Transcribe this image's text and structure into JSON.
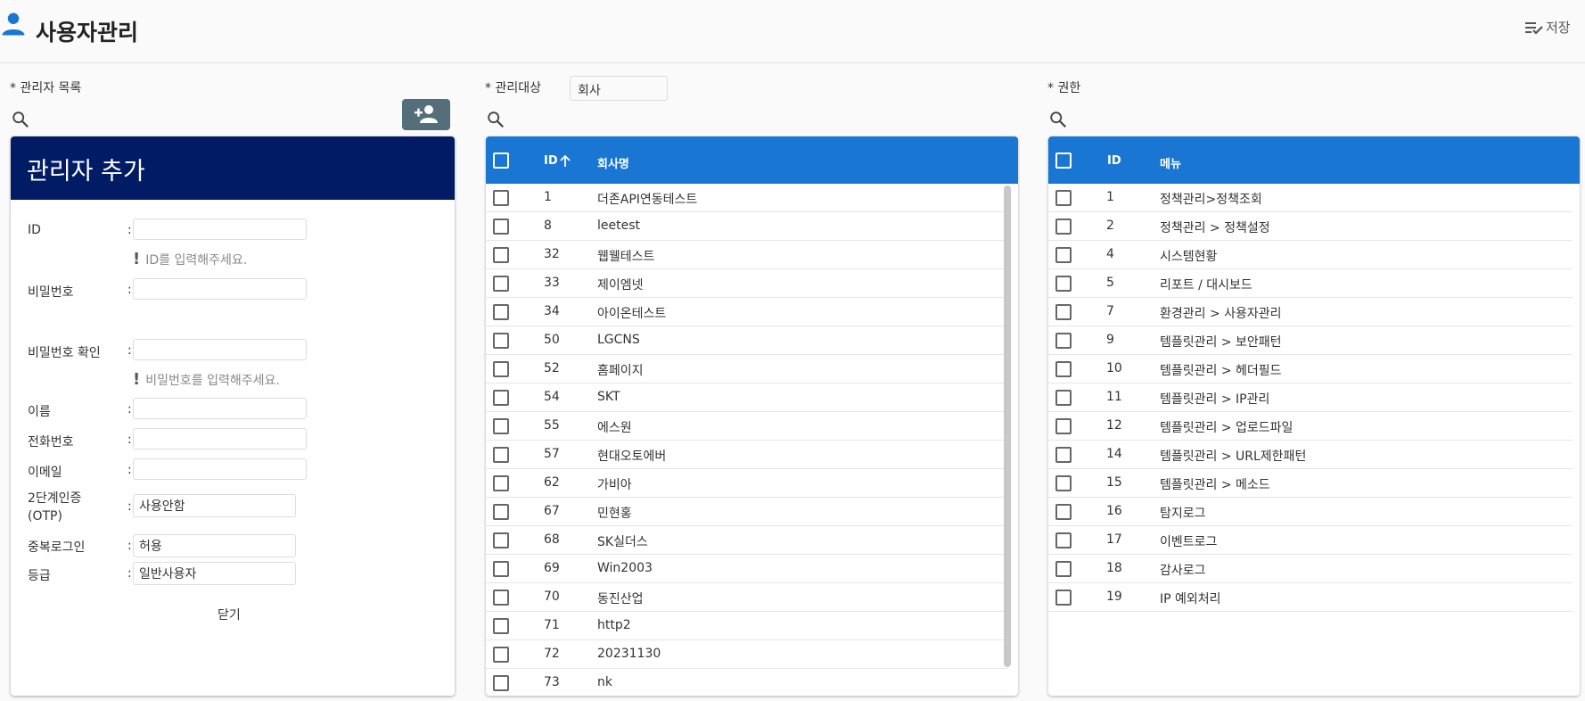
{
  "header": {
    "title": "사용자관리",
    "save_label": "저장"
  },
  "admin_list": {
    "label": "* 관리자 목록",
    "form": {
      "title": "관리자 추가",
      "fields": [
        {
          "label": "ID",
          "value": ""
        },
        {
          "label": "비밀번호",
          "value": ""
        },
        {
          "label": "비밀번호 확인",
          "value": ""
        },
        {
          "label": "이름",
          "value": ""
        },
        {
          "label": "전화번호",
          "value": ""
        },
        {
          "label": "이메일",
          "value": ""
        },
        {
          "label": "2단계인증",
          "label2": "(OTP)",
          "value": "사용안함"
        },
        {
          "label": "중복로그인",
          "value": "허용"
        },
        {
          "label": "등급",
          "value": "일반사용자"
        }
      ],
      "colon": ":",
      "id_help": "ID를 입력해주세요.",
      "pw_help": "비밀번호를 입력해주세요.",
      "close_label": "닫기"
    }
  },
  "target": {
    "label": "* 관리대상",
    "select_value": "회사",
    "columns": {
      "id": "ID",
      "name": "회사명"
    },
    "sort": "ascending",
    "rows": [
      {
        "id": "1",
        "name": "더존API연동테스트"
      },
      {
        "id": "8",
        "name": "leetest"
      },
      {
        "id": "32",
        "name": "웹웰테스트"
      },
      {
        "id": "33",
        "name": "제이엠넷"
      },
      {
        "id": "34",
        "name": "아이온테스트"
      },
      {
        "id": "50",
        "name": "LGCNS"
      },
      {
        "id": "52",
        "name": "홈페이지"
      },
      {
        "id": "54",
        "name": "SKT"
      },
      {
        "id": "55",
        "name": "에스원"
      },
      {
        "id": "57",
        "name": "현대오토에버"
      },
      {
        "id": "62",
        "name": "가비아"
      },
      {
        "id": "67",
        "name": "민현홍"
      },
      {
        "id": "68",
        "name": "SK실더스"
      },
      {
        "id": "69",
        "name": "Win2003"
      },
      {
        "id": "70",
        "name": "동진산업"
      },
      {
        "id": "71",
        "name": "http2"
      },
      {
        "id": "72",
        "name": "20231130"
      },
      {
        "id": "73",
        "name": "nk"
      }
    ]
  },
  "permission": {
    "label": "* 권한",
    "columns": {
      "id": "ID",
      "name": "메뉴"
    },
    "rows": [
      {
        "id": "1",
        "name": "정책관리>정책조회"
      },
      {
        "id": "2",
        "name": "정책관리 > 정책설정"
      },
      {
        "id": "4",
        "name": "시스템현황"
      },
      {
        "id": "5",
        "name": "리포트 / 대시보드"
      },
      {
        "id": "7",
        "name": "환경관리 > 사용자관리"
      },
      {
        "id": "9",
        "name": "템플릿관리 > 보안패턴"
      },
      {
        "id": "10",
        "name": "템플릿관리 > 헤더필드"
      },
      {
        "id": "11",
        "name": "템플릿관리 > IP관리"
      },
      {
        "id": "12",
        "name": "템플릿관리 > 업로드파일"
      },
      {
        "id": "14",
        "name": "템플릿관리 > URL제한패턴"
      },
      {
        "id": "15",
        "name": "템플릿관리 > 메소드"
      },
      {
        "id": "16",
        "name": "탐지로그"
      },
      {
        "id": "17",
        "name": "이벤트로그"
      },
      {
        "id": "18",
        "name": "감사로그"
      },
      {
        "id": "19",
        "name": "IP 예외처리"
      }
    ]
  },
  "colors": {
    "brand": "#1976d2",
    "panel_header": "#011c65",
    "add_button": "#546e7a"
  }
}
